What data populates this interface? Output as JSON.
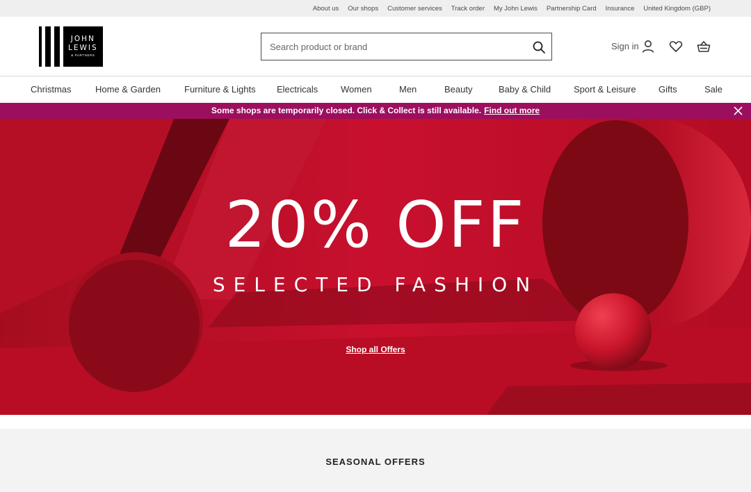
{
  "utility_links": [
    "About us",
    "Our shops",
    "Customer services",
    "Track order",
    "My John Lewis",
    "Partnership Card",
    "Insurance",
    "United Kingdom (GBP)"
  ],
  "logo": {
    "line1": "JOHN",
    "line2": "LEWIS",
    "line3": "& PARTNERS"
  },
  "search": {
    "placeholder": "Search product or brand",
    "icon": "search-icon"
  },
  "account": {
    "signin_label": "Sign in",
    "icons": [
      "user-icon",
      "heart-icon",
      "basket-icon"
    ]
  },
  "nav": [
    "Christmas",
    "Home & Garden",
    "Furniture & Lights",
    "Electricals",
    "Women",
    "Men",
    "Beauty",
    "Baby & Child",
    "Sport & Leisure",
    "Gifts",
    "Sale"
  ],
  "notice": {
    "text": "Some shops are temporarily closed. Click & Collect is still available.",
    "link": "Find out more",
    "color": "#9c0f5f"
  },
  "hero": {
    "title": "20% OFF",
    "subtitle": "SELECTED FASHION",
    "link": "Shop all Offers",
    "color": "#c8102e"
  },
  "section": {
    "title": "SEASONAL OFFERS"
  }
}
